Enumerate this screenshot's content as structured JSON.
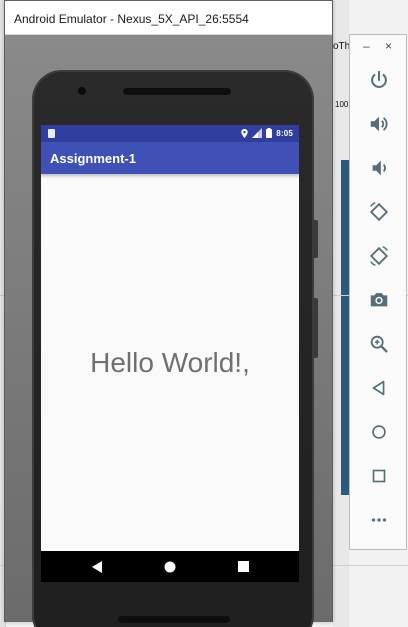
{
  "background": {
    "fragments": [
      "oTh",
      "100"
    ]
  },
  "window": {
    "title": "Android Emulator - Nexus_5X_API_26:5554"
  },
  "status_bar": {
    "time": "8:05",
    "icons": [
      "sim-icon",
      "location-icon",
      "signal-icon",
      "battery-icon"
    ]
  },
  "app_bar": {
    "title": "Assignment-1"
  },
  "content": {
    "text": "Hello World!,"
  },
  "nav": {
    "buttons": [
      "back-icon",
      "home-icon",
      "recents-icon"
    ]
  },
  "toolbar": {
    "minimize": "–",
    "close": "×",
    "buttons": [
      "power-icon",
      "volume-up-icon",
      "volume-down-icon",
      "rotate-left-icon",
      "rotate-right-icon",
      "camera-icon",
      "zoom-icon",
      "back-icon",
      "home-icon",
      "overview-icon",
      "more-icon"
    ]
  },
  "colors": {
    "status_bar": "#303f9f",
    "app_bar": "#3f51b5",
    "toolbar_icon": "#546e7a",
    "hello_text": "#707070"
  }
}
